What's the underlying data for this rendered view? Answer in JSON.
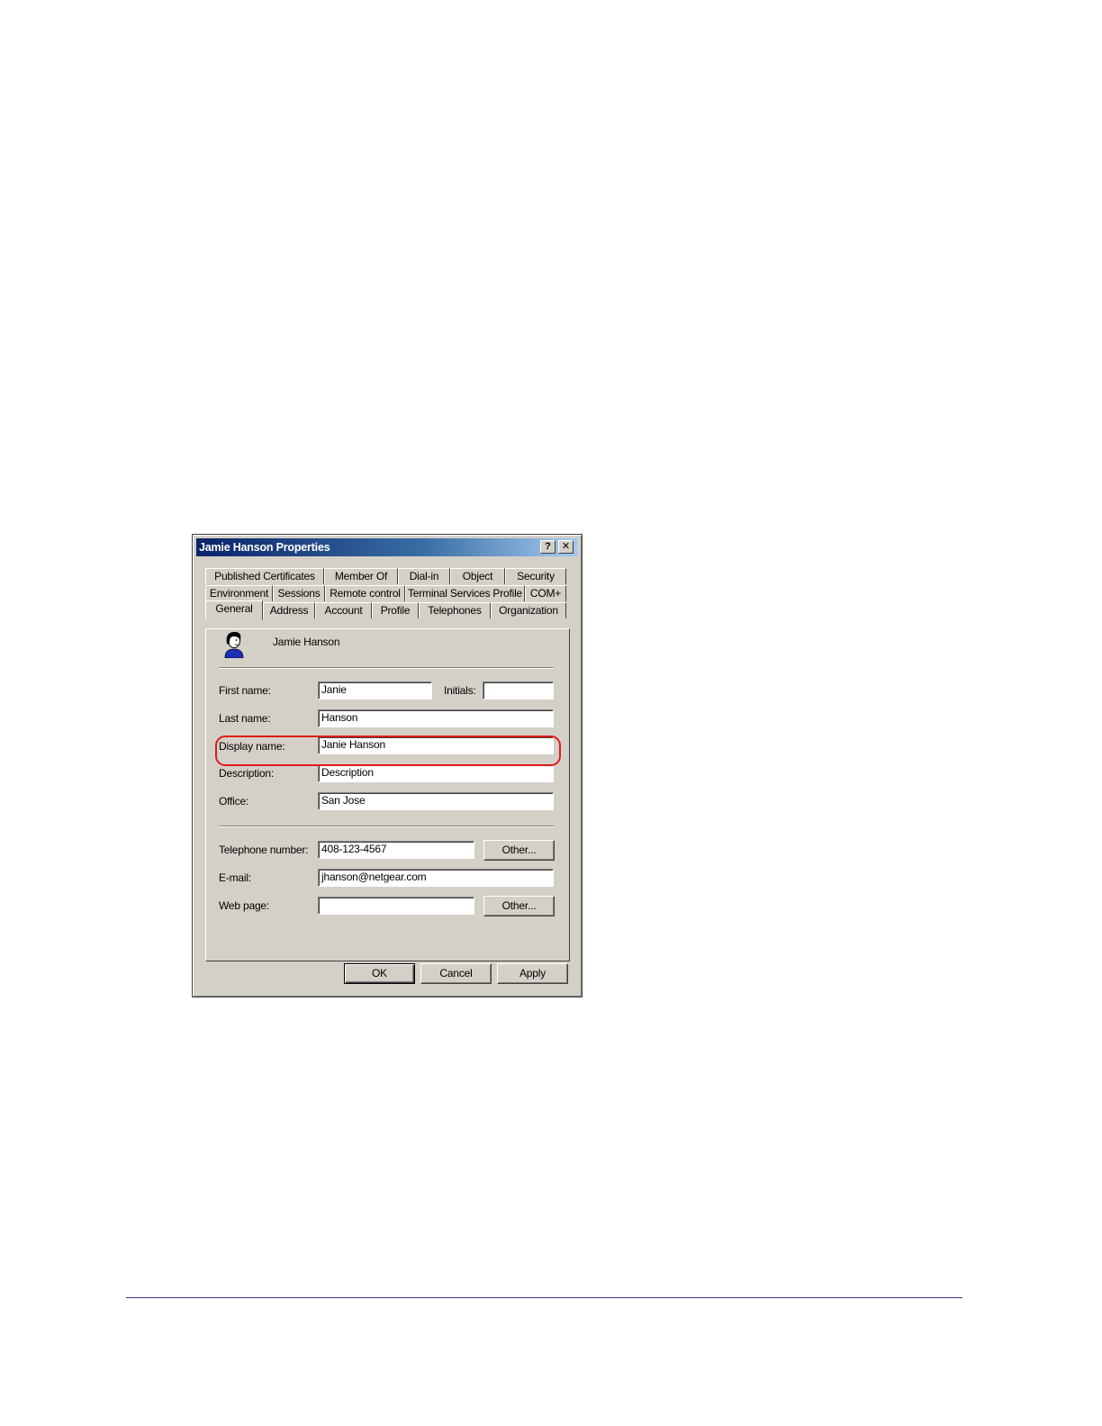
{
  "window": {
    "title": "Jamie Hanson Properties",
    "help_label": "?",
    "close_label": "✕"
  },
  "tabs": {
    "row1": [
      "Published Certificates",
      "Member Of",
      "Dial-in",
      "Object",
      "Security"
    ],
    "row2": [
      "Environment",
      "Sessions",
      "Remote control",
      "Terminal Services Profile",
      "COM+"
    ],
    "row3": [
      "General",
      "Address",
      "Account",
      "Profile",
      "Telephones",
      "Organization"
    ],
    "active": "General"
  },
  "user": {
    "name": "Jamie Hanson",
    "icon": "user-icon"
  },
  "form": {
    "first_name_label": "First name:",
    "first_name": "Janie",
    "initials_label": "Initials:",
    "initials": "",
    "last_name_label": "Last name:",
    "last_name": "Hanson",
    "display_name_label": "Display name:",
    "display_name": "Janie Hanson",
    "description_label": "Description:",
    "description": "Description",
    "office_label": "Office:",
    "office": "San Jose",
    "telephone_label": "Telephone number:",
    "telephone": "408-123-4567",
    "email_label": "E-mail:",
    "email": "jhanson@netgear.com",
    "webpage_label": "Web page:",
    "webpage": "",
    "other_label": "Other..."
  },
  "buttons": {
    "ok": "OK",
    "cancel": "Cancel",
    "apply": "Apply"
  },
  "colors": {
    "highlight": "#e01b1b",
    "titlebar_start": "#0a246a",
    "footer_rule": "#3333aa"
  }
}
